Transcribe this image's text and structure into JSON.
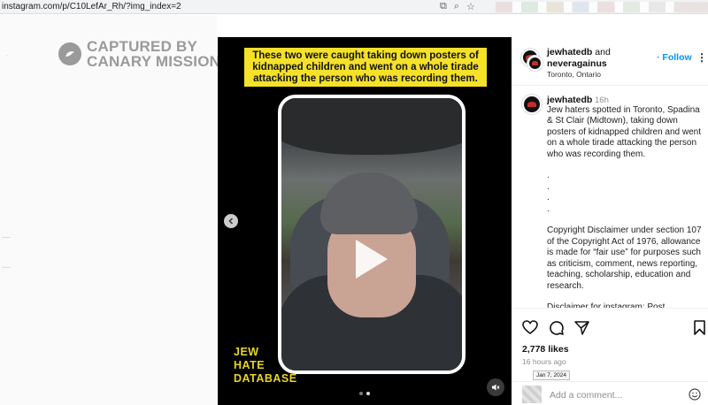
{
  "browser": {
    "url": "instagram.com/p/C10LefAr_Rh/?img_index=2"
  },
  "watermark": {
    "line1": "CAPTURED BY",
    "line2": "CANARY MISSION"
  },
  "media": {
    "caption": "These two were caught taking down posters of kidnapped children and went on a whole tirade attacking the person who was recording them.",
    "brand_line1": "JEW",
    "brand_line2": "HATE",
    "brand_line3": "DATABASE",
    "carousel_dots": 2,
    "active_dot": 2
  },
  "header": {
    "user1": "jewhatedb",
    "and": " and",
    "user2": "neveragainus",
    "location": "Toronto, Ontario",
    "follow_label": "· Follow",
    "more_label": "⋮"
  },
  "post": {
    "username": "jewhatedb",
    "time": "16h",
    "body": "Jew haters spotted in Toronto, Spadina & St Clair (Midtown), taking down posters of kidnapped children and went on a whole tirade attacking the person who was recording them.\n\n.\n.\n.\n.\n\nCopyright Disclaimer under section 107 of the Copyright Act of 1976, allowance is made for “fair use” for purposes such as criticism, comment, news reporting, teaching, scholarship, education and research.\n\nDisclaimer for instagram: Post"
  },
  "actions": {
    "likes": "2,778 likes",
    "ago": "16 hours ago",
    "tooltip": "Jan 7, 2024",
    "comment_placeholder": "Add a comment..."
  },
  "colors": {
    "caption_bg": "#f5e12a",
    "brand_text": "#e8d524",
    "follow": "#0095f6"
  }
}
